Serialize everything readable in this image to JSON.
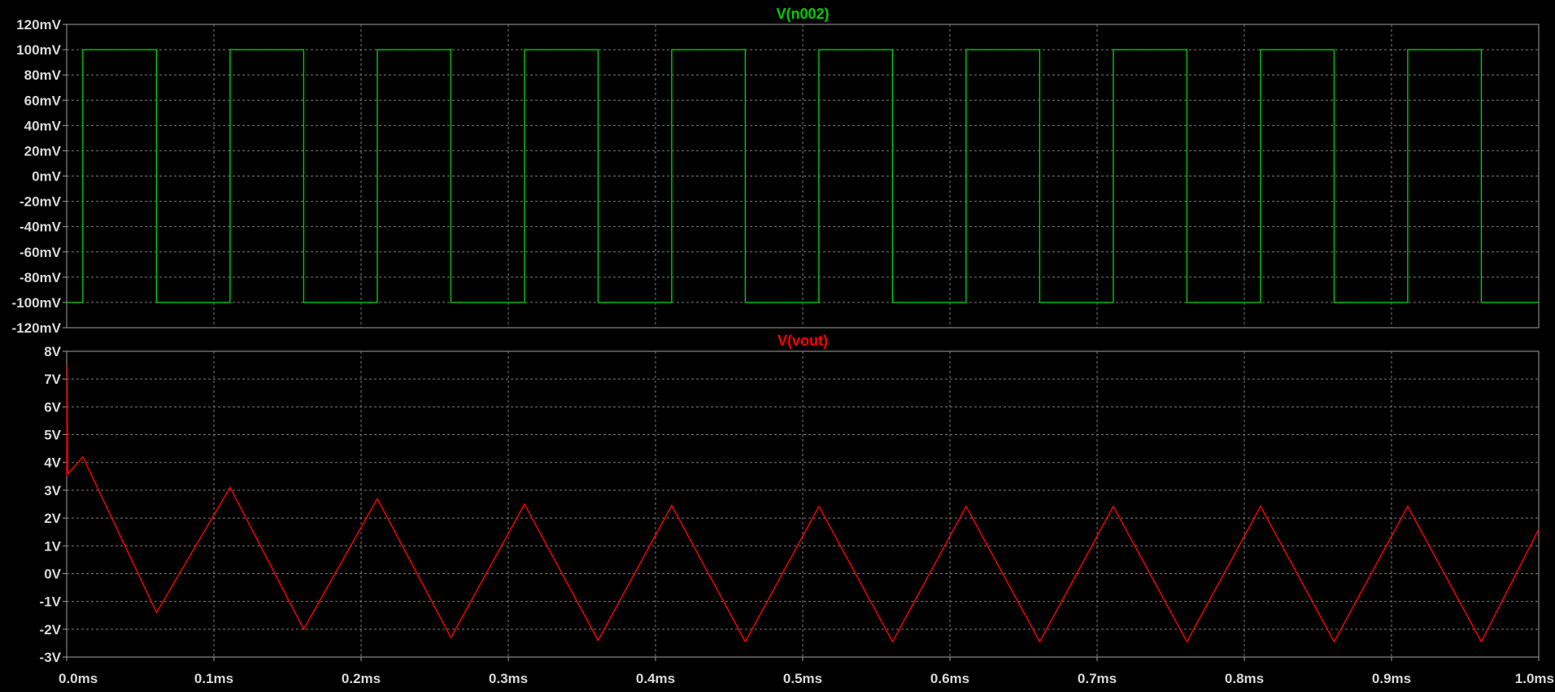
{
  "colors": {
    "background": "#000000",
    "frame": "#a0a0a0",
    "grid": "#7a7a7a",
    "axis_text": "#d8d8d8",
    "trace_top": "#00cc00",
    "trace_bottom": "#ff0000"
  },
  "chart_data": [
    {
      "type": "line",
      "title": "V(n002)",
      "color": "#00cc00",
      "xlim": [
        0,
        1.0
      ],
      "x_unit": "ms",
      "ylim": [
        -120,
        120
      ],
      "y_unit": "mV",
      "grid": true,
      "y_tick_labels": [
        {
          "value": 120,
          "label": "120mV"
        },
        {
          "value": 100,
          "label": "100mV"
        },
        {
          "value": 80,
          "label": "80mV"
        },
        {
          "value": 60,
          "label": "60mV"
        },
        {
          "value": 40,
          "label": "40mV"
        },
        {
          "value": 20,
          "label": "20mV"
        },
        {
          "value": 0,
          "label": "0mV"
        },
        {
          "value": -20,
          "label": "-20mV"
        },
        {
          "value": -40,
          "label": "-40mV"
        },
        {
          "value": -60,
          "label": "-60mV"
        },
        {
          "value": -80,
          "label": "-80mV"
        },
        {
          "value": -100,
          "label": "-100mV"
        },
        {
          "value": -120,
          "label": "-120mV"
        }
      ],
      "series": [
        {
          "x": [
            0,
            0.011,
            0.011,
            0.061,
            0.061,
            0.111,
            0.111,
            0.161,
            0.161,
            0.211,
            0.211,
            0.261,
            0.261,
            0.311,
            0.311,
            0.361,
            0.361,
            0.411,
            0.411,
            0.461,
            0.461,
            0.511,
            0.511,
            0.561,
            0.561,
            0.611,
            0.611,
            0.661,
            0.661,
            0.711,
            0.711,
            0.761,
            0.761,
            0.811,
            0.811,
            0.861,
            0.861,
            0.911,
            0.911,
            0.961,
            0.961,
            1.0
          ],
          "y": [
            -100,
            -100,
            100,
            100,
            -100,
            -100,
            100,
            100,
            -100,
            -100,
            100,
            100,
            -100,
            -100,
            100,
            100,
            -100,
            -100,
            100,
            100,
            -100,
            -100,
            100,
            100,
            -100,
            -100,
            100,
            100,
            -100,
            -100,
            100,
            100,
            -100,
            -100,
            100,
            100,
            -100,
            -100,
            100,
            100,
            -100,
            -100
          ]
        }
      ]
    },
    {
      "type": "line",
      "title": "V(vout)",
      "color": "#ff0000",
      "xlim": [
        0,
        1.0
      ],
      "x_unit": "ms",
      "ylim": [
        -3,
        8
      ],
      "y_unit": "V",
      "grid": true,
      "y_tick_labels": [
        {
          "value": 8,
          "label": "8V"
        },
        {
          "value": 7,
          "label": "7V"
        },
        {
          "value": 6,
          "label": "6V"
        },
        {
          "value": 5,
          "label": "5V"
        },
        {
          "value": 4,
          "label": "4V"
        },
        {
          "value": 3,
          "label": "3V"
        },
        {
          "value": 2,
          "label": "2V"
        },
        {
          "value": 1,
          "label": "1V"
        },
        {
          "value": 0,
          "label": "0V"
        },
        {
          "value": -1,
          "label": "-1V"
        },
        {
          "value": -2,
          "label": "-2V"
        },
        {
          "value": -3,
          "label": "-3V"
        }
      ],
      "x_tick_labels": [
        {
          "value": 0.0,
          "label": "0.0ms"
        },
        {
          "value": 0.1,
          "label": "0.1ms"
        },
        {
          "value": 0.2,
          "label": "0.2ms"
        },
        {
          "value": 0.3,
          "label": "0.3ms"
        },
        {
          "value": 0.4,
          "label": "0.4ms"
        },
        {
          "value": 0.5,
          "label": "0.5ms"
        },
        {
          "value": 0.6,
          "label": "0.6ms"
        },
        {
          "value": 0.7,
          "label": "0.7ms"
        },
        {
          "value": 0.8,
          "label": "0.8ms"
        },
        {
          "value": 0.9,
          "label": "0.9ms"
        },
        {
          "value": 1.0,
          "label": "1.0ms"
        }
      ],
      "series": [
        {
          "x": [
            0,
            0.0003,
            0.0006,
            0.001,
            0.011,
            0.061,
            0.111,
            0.161,
            0.211,
            0.261,
            0.311,
            0.361,
            0.411,
            0.461,
            0.511,
            0.561,
            0.611,
            0.661,
            0.711,
            0.761,
            0.811,
            0.861,
            0.911,
            0.961,
            1.0
          ],
          "y": [
            3.5,
            7.5,
            3.8,
            3.6,
            4.2,
            -1.4,
            3.1,
            -2.0,
            2.7,
            -2.3,
            2.5,
            -2.4,
            2.45,
            -2.45,
            2.42,
            -2.45,
            2.42,
            -2.45,
            2.42,
            -2.45,
            2.42,
            -2.45,
            2.42,
            -2.45,
            1.6
          ]
        }
      ]
    }
  ]
}
